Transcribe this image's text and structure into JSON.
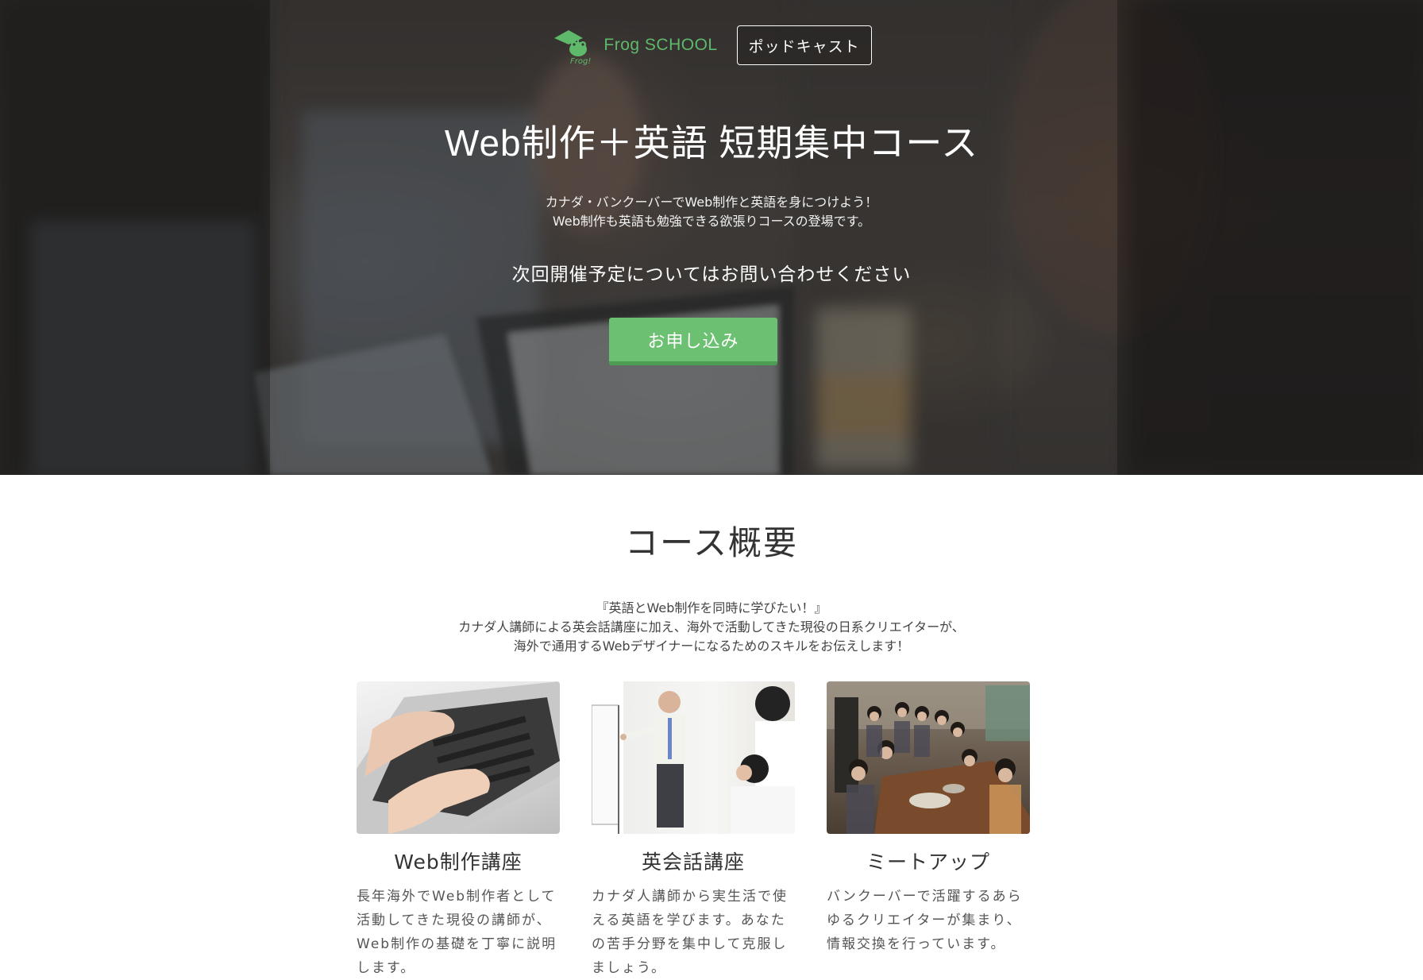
{
  "header": {
    "logo_text": "Frog SCHOOL",
    "logo_icon": "frog-icon",
    "podcast_label": "ポッドキャスト"
  },
  "hero": {
    "title": "Web制作＋英語 短期集中コース",
    "desc_line1": "カナダ・バンクーバーでWeb制作と英語を身につけよう！",
    "desc_line2": "Web制作も英語も勉強できる欲張りコースの登場です。",
    "next_schedule": "次回開催予定についてはお問い合わせください",
    "apply_label": "お申し込み"
  },
  "overview": {
    "title": "コース概要",
    "intro_line1": "『英語とWeb制作を同時に学びたい！』",
    "intro_line2": "カナダ人講師による英会話講座に加え、海外で活動してきた現役の日系クリエイターが、",
    "intro_line3": "海外で通用するWebデザイナーになるためのスキルをお伝えします！"
  },
  "cards": [
    {
      "title": "Web制作講座",
      "text": "長年海外でWeb制作者として活動してきた現役の講師が、Web制作の基礎を丁寧に説明します。"
    },
    {
      "title": "英会話講座",
      "text": "カナダ人講師から実生活で使える英語を学びます。あなたの苦手分野を集中して克服しましょう。"
    },
    {
      "title": "ミートアップ",
      "text": "バンクーバーで活躍するあらゆるクリエイターが集まり、情報交換を行っています。"
    }
  ],
  "colors": {
    "accent_green": "#6cc072",
    "logo_green": "#5fb96b"
  }
}
